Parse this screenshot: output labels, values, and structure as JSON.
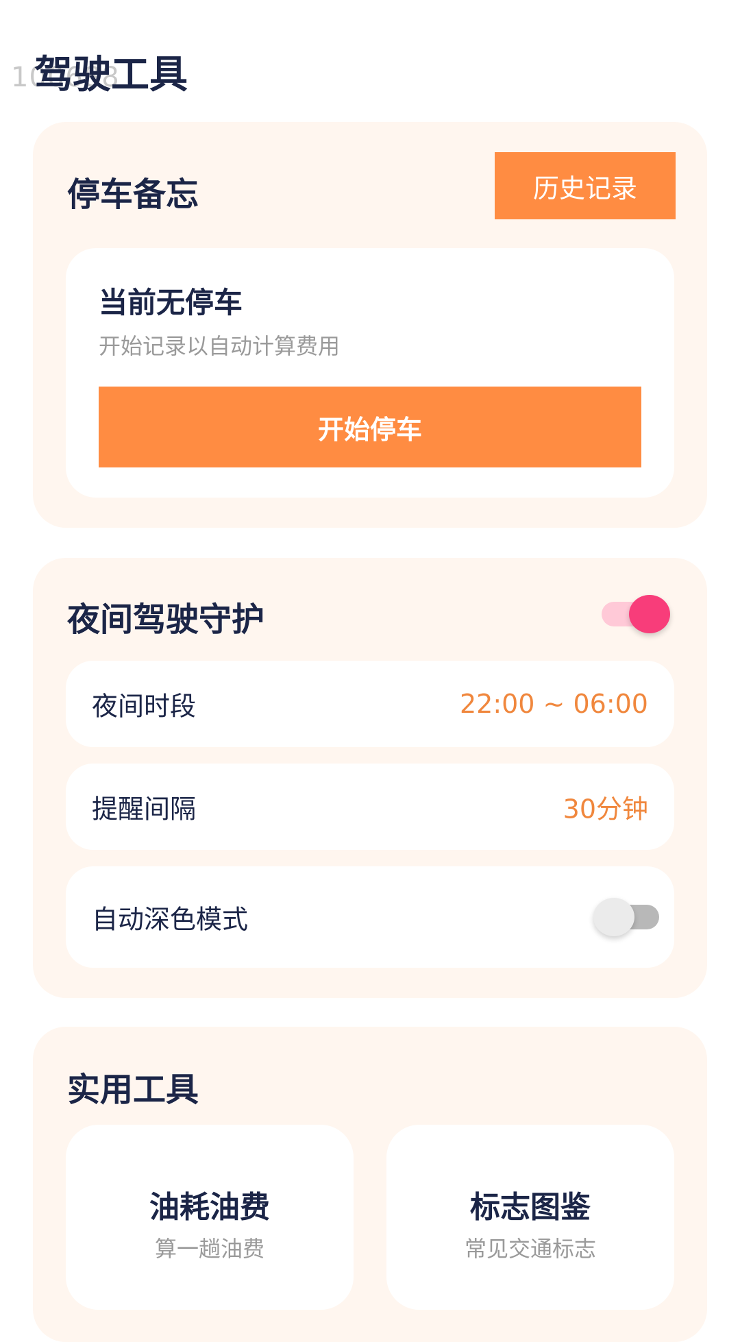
{
  "ghost_text": "100688",
  "header": {
    "title": "驾驶工具"
  },
  "parking": {
    "title": "停车备忘",
    "history_label": "历史记录",
    "status": "当前无停车",
    "hint": "开始记录以自动计算费用",
    "start_label": "开始停车"
  },
  "night_guard": {
    "title": "夜间驾驶守护",
    "enabled": true,
    "rows": [
      {
        "label": "夜间时段",
        "value": "22:00 ~ 06:00"
      },
      {
        "label": "提醒间隔",
        "value": "30分钟"
      },
      {
        "label": "自动深色模式",
        "enabled": false
      }
    ]
  },
  "tools": {
    "title": "实用工具",
    "items": [
      {
        "name": "油耗油费",
        "desc": "算一趟油费"
      },
      {
        "name": "标志图鉴",
        "desc": "常见交通标志"
      }
    ]
  },
  "colors": {
    "accent": "#ff8c42",
    "toggle_on": "#f83d7a",
    "card_bg": "#fff6ef",
    "title_text": "#1b2547"
  }
}
